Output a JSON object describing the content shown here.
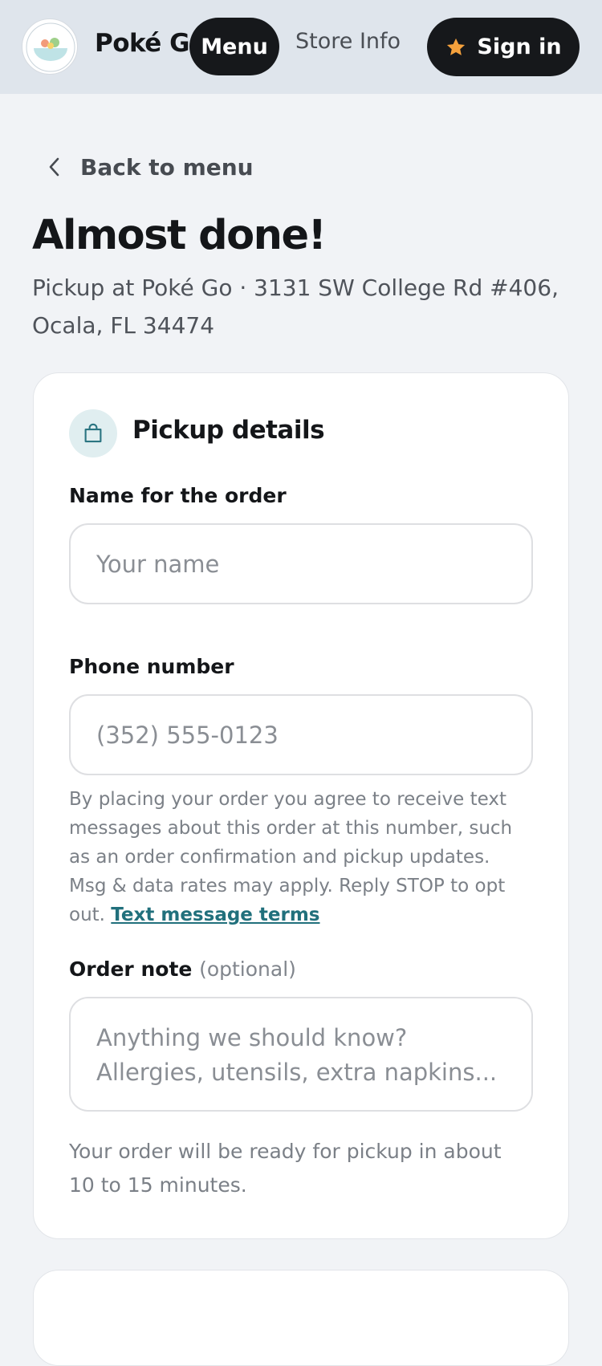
{
  "header": {
    "brand_name": "Poké Go",
    "logo_text": "POKÉ GO",
    "nav_menu_label": "Menu",
    "nav_store_label": "Store Info",
    "signin_label": "Sign in",
    "signin_icon": "star-icon",
    "accent_color": "#f5a13c"
  },
  "page": {
    "back_label": "Back to menu",
    "title": "Almost done!",
    "subtitle": "Pickup at Poké Go · 3131 SW College Rd #406, Ocala, FL 34474"
  },
  "pickup_card": {
    "icon": "shopping-bag-icon",
    "title": "Pickup details",
    "name_label": "Name for the order",
    "name_placeholder": "Your name",
    "name_value": "",
    "phone_label": "Phone number",
    "phone_placeholder": "(352) 555-0123",
    "phone_value": "",
    "sms_disclaimer": "By placing your order you agree to receive text messages about this order at this number, such as an order confirmation and pickup updates. Msg & data rates may apply. Reply STOP to opt out.",
    "sms_terms_link": "Text message terms",
    "note_label": "Order note",
    "note_optional": "(optional)",
    "note_placeholder": "Anything we should know? Allergies, utensils, extra napkins...",
    "note_value": "",
    "ready_text": "Your order will be ready for pickup in about 10 to 15 minutes.",
    "link_color": "#21707c"
  }
}
